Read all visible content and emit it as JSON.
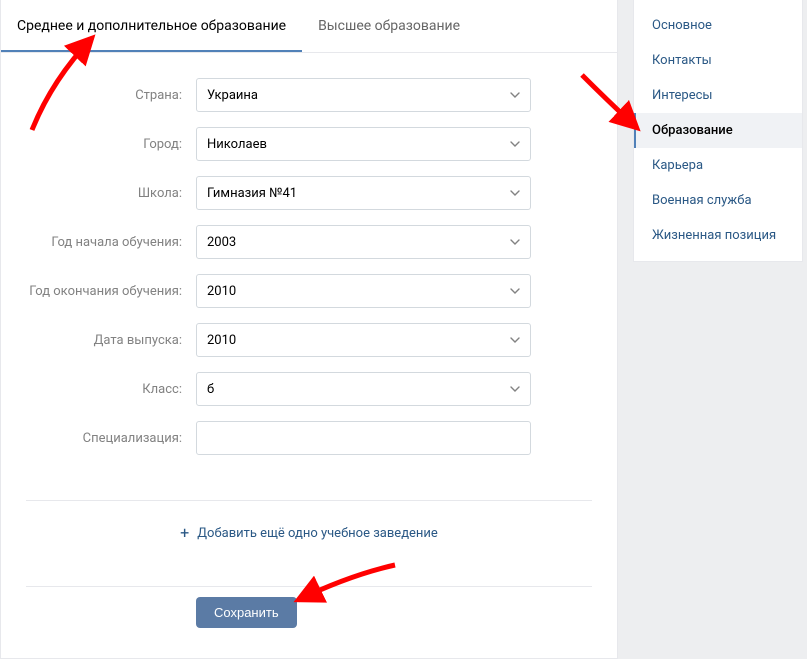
{
  "tabs": [
    {
      "label": "Среднее и дополнительное образование",
      "active": true
    },
    {
      "label": "Высшее образование",
      "active": false
    }
  ],
  "fields": {
    "country": {
      "label": "Страна:",
      "value": "Украина"
    },
    "city": {
      "label": "Город:",
      "value": "Николаев"
    },
    "school": {
      "label": "Школа:",
      "value": "Гимназия №41"
    },
    "yearStart": {
      "label": "Год начала обучения:",
      "value": "2003"
    },
    "yearEnd": {
      "label": "Год окончания обучения:",
      "value": "2010"
    },
    "gradYear": {
      "label": "Дата выпуска:",
      "value": "2010"
    },
    "class": {
      "label": "Класс:",
      "value": "б"
    },
    "spec": {
      "label": "Специализация:",
      "value": ""
    }
  },
  "addLink": "Добавить ещё одно учебное заведение",
  "saveLabel": "Сохранить",
  "sidebar": {
    "items": [
      {
        "label": "Основное",
        "active": false
      },
      {
        "label": "Контакты",
        "active": false
      },
      {
        "label": "Интересы",
        "active": false
      },
      {
        "label": "Образование",
        "active": true
      },
      {
        "label": "Карьера",
        "active": false
      },
      {
        "label": "Военная служба",
        "active": false
      },
      {
        "label": "Жизненная позиция",
        "active": false
      }
    ]
  }
}
